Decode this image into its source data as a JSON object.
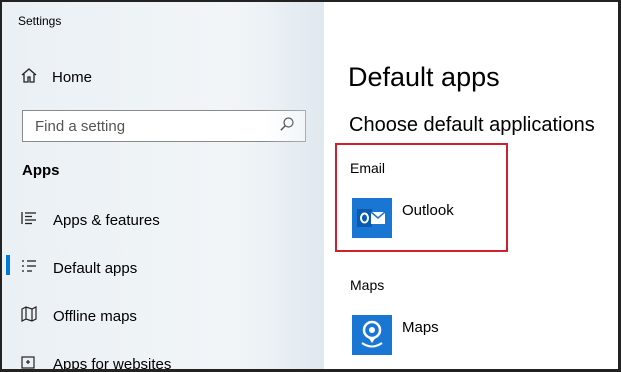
{
  "window": {
    "title": "Settings"
  },
  "sidebar": {
    "home_label": "Home",
    "search_placeholder": "Find a setting",
    "section_label": "Apps",
    "items": [
      {
        "label": "Apps & features",
        "icon": "list-icon"
      },
      {
        "label": "Default apps",
        "icon": "default-apps-icon",
        "active": true
      },
      {
        "label": "Offline maps",
        "icon": "map-icon"
      },
      {
        "label": "Apps for websites",
        "icon": "web-app-icon"
      }
    ]
  },
  "main": {
    "title": "Default apps",
    "subtitle": "Choose default applications",
    "categories": [
      {
        "label": "Email",
        "app": "Outlook",
        "icon": "outlook-icon"
      },
      {
        "label": "Maps",
        "app": "Maps",
        "icon": "maps-icon"
      }
    ]
  },
  "colors": {
    "accent": "#0078d7",
    "app_tile": "#1976d2",
    "highlight": "#d0202d"
  }
}
